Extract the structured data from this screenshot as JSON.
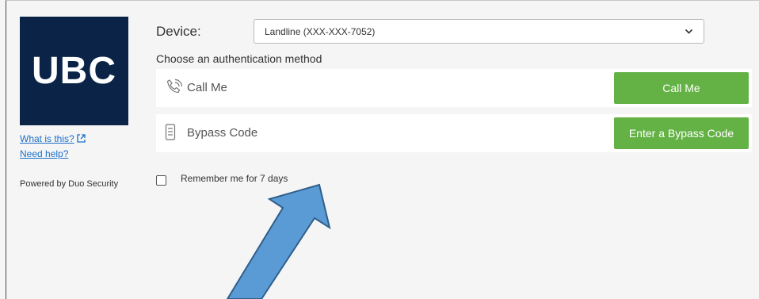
{
  "sidebar": {
    "logo_text": "UBC",
    "what_is_this": "What is this?",
    "need_help": "Need help?",
    "powered_by": "Powered by Duo Security"
  },
  "device": {
    "label": "Device:",
    "selected": "Landline (XXX-XXX-7052)"
  },
  "auth": {
    "choose_label": "Choose an authentication method",
    "methods": [
      {
        "label": "Call Me",
        "button": "Call Me",
        "icon": "phone-icon"
      },
      {
        "label": "Bypass Code",
        "button": "Enter a Bypass Code",
        "icon": "passcode-icon"
      }
    ]
  },
  "remember": {
    "label": "Remember me for 7 days",
    "checked": false
  },
  "colors": {
    "logo_bg": "#0b2347",
    "button_green": "#64b246",
    "link_blue": "#1a6fc9",
    "arrow_fill": "#5b9bd5"
  }
}
